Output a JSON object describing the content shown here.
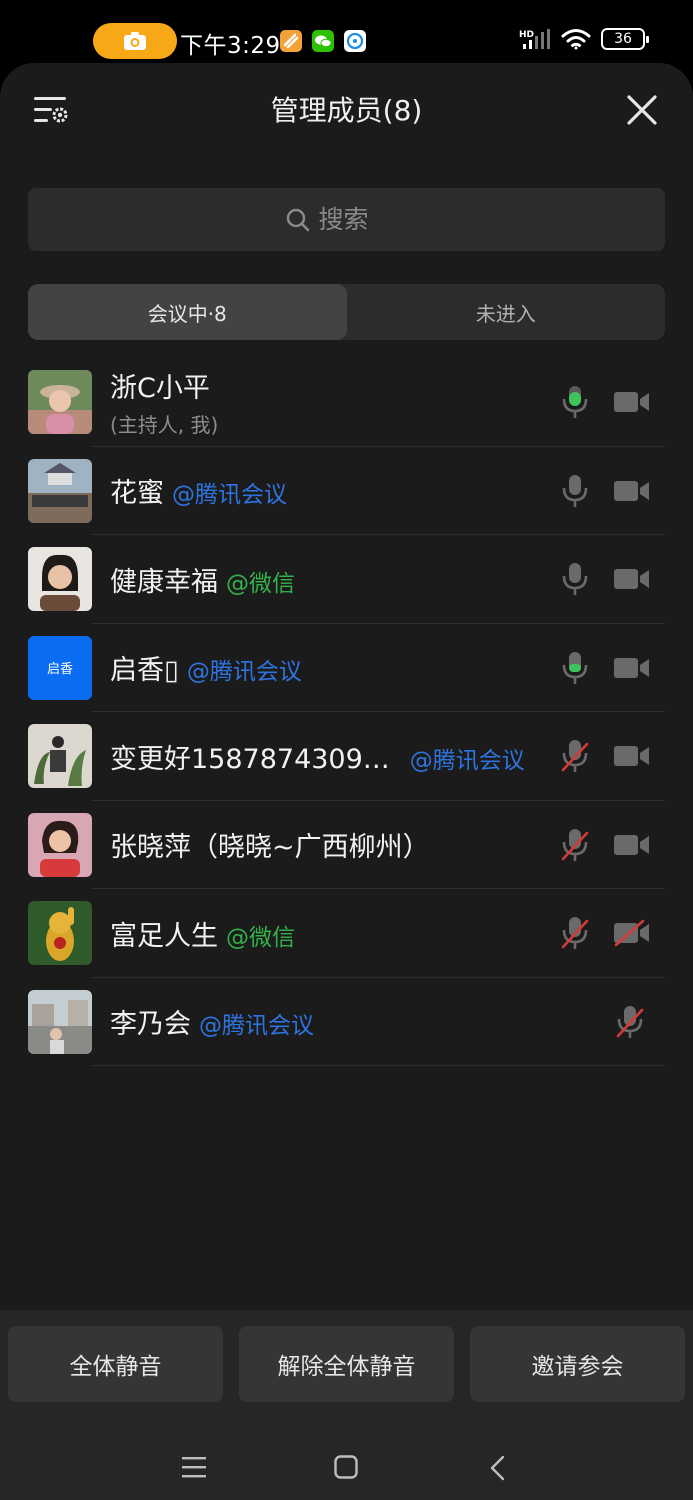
{
  "status_bar": {
    "time": "下午3:29",
    "network_label": "HD",
    "battery": "36",
    "recording_color": "#f6a817"
  },
  "header": {
    "title": "管理成员(8)"
  },
  "search": {
    "placeholder": "搜索"
  },
  "tabs": [
    {
      "label": "会议中·8",
      "active": true
    },
    {
      "label": "未进入",
      "active": false
    }
  ],
  "members": [
    {
      "name": "浙C小平",
      "tag": "",
      "tag_type": "",
      "sub": "(主持人, 我)",
      "mic": "speaking",
      "cam": "off-icon",
      "avatar": "photo-woman-hat"
    },
    {
      "name": "花蜜",
      "tag": "@腾讯会议",
      "tag_type": "tencent",
      "sub": "",
      "mic": "on",
      "cam": "off-icon",
      "avatar": "photo-group"
    },
    {
      "name": "健康幸福",
      "tag": "@微信",
      "tag_type": "wechat",
      "sub": "",
      "mic": "on",
      "cam": "off-icon",
      "avatar": "photo-woman"
    },
    {
      "name": "启香▯",
      "tag": "@腾讯会议",
      "tag_type": "tencent",
      "sub": "",
      "mic": "speaking-low",
      "cam": "off-icon",
      "avatar": "text-avatar",
      "avatar_text": "启香"
    },
    {
      "name": "变更好1587874309…",
      "tag": "@腾讯会议",
      "tag_type": "tencent",
      "sub": "",
      "mic": "muted",
      "cam": "off-icon",
      "avatar": "photo-plants"
    },
    {
      "name": "张晓萍（晓晓~广西柳州）",
      "tag": "",
      "tag_type": "",
      "sub": "",
      "mic": "muted",
      "cam": "off-icon",
      "avatar": "photo-woman-red"
    },
    {
      "name": "富足人生",
      "tag": "@微信",
      "tag_type": "wechat",
      "sub": "",
      "mic": "muted",
      "cam": "disabled",
      "avatar": "photo-cat"
    },
    {
      "name": "李乃会",
      "tag": "@腾讯会议",
      "tag_type": "tencent",
      "sub": "",
      "mic": "muted-only",
      "cam": "none",
      "avatar": "photo-street"
    }
  ],
  "footer": {
    "mute_all": "全体静音",
    "unmute_all": "解除全体静音",
    "invite": "邀请参会"
  },
  "colors": {
    "background": "#1b1b1b",
    "speaking_green": "#3ec45a",
    "muted_red": "#d33b3b",
    "tencent_blue": "#2e74e0",
    "wechat_green": "#33b24a"
  }
}
